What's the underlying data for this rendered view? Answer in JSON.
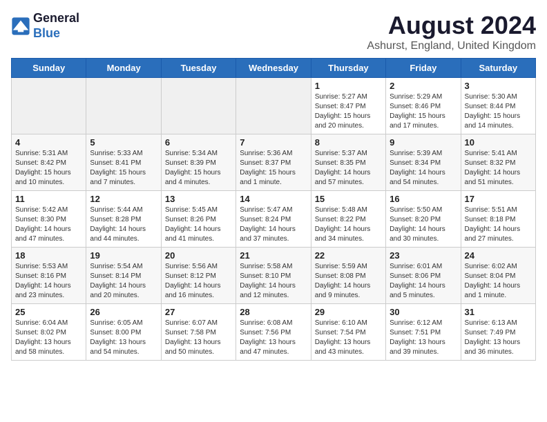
{
  "header": {
    "logo_line1": "General",
    "logo_line2": "Blue",
    "title": "August 2024",
    "subtitle": "Ashurst, England, United Kingdom"
  },
  "weekdays": [
    "Sunday",
    "Monday",
    "Tuesday",
    "Wednesday",
    "Thursday",
    "Friday",
    "Saturday"
  ],
  "weeks": [
    [
      {
        "day": "",
        "info": ""
      },
      {
        "day": "",
        "info": ""
      },
      {
        "day": "",
        "info": ""
      },
      {
        "day": "",
        "info": ""
      },
      {
        "day": "1",
        "info": "Sunrise: 5:27 AM\nSunset: 8:47 PM\nDaylight: 15 hours\nand 20 minutes."
      },
      {
        "day": "2",
        "info": "Sunrise: 5:29 AM\nSunset: 8:46 PM\nDaylight: 15 hours\nand 17 minutes."
      },
      {
        "day": "3",
        "info": "Sunrise: 5:30 AM\nSunset: 8:44 PM\nDaylight: 15 hours\nand 14 minutes."
      }
    ],
    [
      {
        "day": "4",
        "info": "Sunrise: 5:31 AM\nSunset: 8:42 PM\nDaylight: 15 hours\nand 10 minutes."
      },
      {
        "day": "5",
        "info": "Sunrise: 5:33 AM\nSunset: 8:41 PM\nDaylight: 15 hours\nand 7 minutes."
      },
      {
        "day": "6",
        "info": "Sunrise: 5:34 AM\nSunset: 8:39 PM\nDaylight: 15 hours\nand 4 minutes."
      },
      {
        "day": "7",
        "info": "Sunrise: 5:36 AM\nSunset: 8:37 PM\nDaylight: 15 hours\nand 1 minute."
      },
      {
        "day": "8",
        "info": "Sunrise: 5:37 AM\nSunset: 8:35 PM\nDaylight: 14 hours\nand 57 minutes."
      },
      {
        "day": "9",
        "info": "Sunrise: 5:39 AM\nSunset: 8:34 PM\nDaylight: 14 hours\nand 54 minutes."
      },
      {
        "day": "10",
        "info": "Sunrise: 5:41 AM\nSunset: 8:32 PM\nDaylight: 14 hours\nand 51 minutes."
      }
    ],
    [
      {
        "day": "11",
        "info": "Sunrise: 5:42 AM\nSunset: 8:30 PM\nDaylight: 14 hours\nand 47 minutes."
      },
      {
        "day": "12",
        "info": "Sunrise: 5:44 AM\nSunset: 8:28 PM\nDaylight: 14 hours\nand 44 minutes."
      },
      {
        "day": "13",
        "info": "Sunrise: 5:45 AM\nSunset: 8:26 PM\nDaylight: 14 hours\nand 41 minutes."
      },
      {
        "day": "14",
        "info": "Sunrise: 5:47 AM\nSunset: 8:24 PM\nDaylight: 14 hours\nand 37 minutes."
      },
      {
        "day": "15",
        "info": "Sunrise: 5:48 AM\nSunset: 8:22 PM\nDaylight: 14 hours\nand 34 minutes."
      },
      {
        "day": "16",
        "info": "Sunrise: 5:50 AM\nSunset: 8:20 PM\nDaylight: 14 hours\nand 30 minutes."
      },
      {
        "day": "17",
        "info": "Sunrise: 5:51 AM\nSunset: 8:18 PM\nDaylight: 14 hours\nand 27 minutes."
      }
    ],
    [
      {
        "day": "18",
        "info": "Sunrise: 5:53 AM\nSunset: 8:16 PM\nDaylight: 14 hours\nand 23 minutes."
      },
      {
        "day": "19",
        "info": "Sunrise: 5:54 AM\nSunset: 8:14 PM\nDaylight: 14 hours\nand 20 minutes."
      },
      {
        "day": "20",
        "info": "Sunrise: 5:56 AM\nSunset: 8:12 PM\nDaylight: 14 hours\nand 16 minutes."
      },
      {
        "day": "21",
        "info": "Sunrise: 5:58 AM\nSunset: 8:10 PM\nDaylight: 14 hours\nand 12 minutes."
      },
      {
        "day": "22",
        "info": "Sunrise: 5:59 AM\nSunset: 8:08 PM\nDaylight: 14 hours\nand 9 minutes."
      },
      {
        "day": "23",
        "info": "Sunrise: 6:01 AM\nSunset: 8:06 PM\nDaylight: 14 hours\nand 5 minutes."
      },
      {
        "day": "24",
        "info": "Sunrise: 6:02 AM\nSunset: 8:04 PM\nDaylight: 14 hours\nand 1 minute."
      }
    ],
    [
      {
        "day": "25",
        "info": "Sunrise: 6:04 AM\nSunset: 8:02 PM\nDaylight: 13 hours\nand 58 minutes."
      },
      {
        "day": "26",
        "info": "Sunrise: 6:05 AM\nSunset: 8:00 PM\nDaylight: 13 hours\nand 54 minutes."
      },
      {
        "day": "27",
        "info": "Sunrise: 6:07 AM\nSunset: 7:58 PM\nDaylight: 13 hours\nand 50 minutes."
      },
      {
        "day": "28",
        "info": "Sunrise: 6:08 AM\nSunset: 7:56 PM\nDaylight: 13 hours\nand 47 minutes."
      },
      {
        "day": "29",
        "info": "Sunrise: 6:10 AM\nSunset: 7:54 PM\nDaylight: 13 hours\nand 43 minutes."
      },
      {
        "day": "30",
        "info": "Sunrise: 6:12 AM\nSunset: 7:51 PM\nDaylight: 13 hours\nand 39 minutes."
      },
      {
        "day": "31",
        "info": "Sunrise: 6:13 AM\nSunset: 7:49 PM\nDaylight: 13 hours\nand 36 minutes."
      }
    ]
  ]
}
